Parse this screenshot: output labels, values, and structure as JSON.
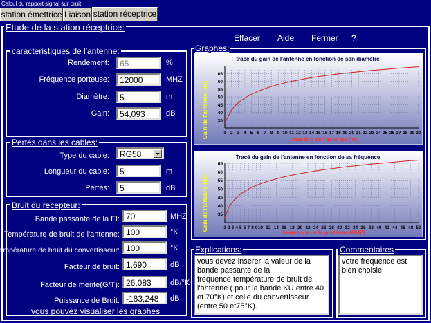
{
  "window_title": "Calcul du rapport signal sur bruit",
  "tabs": [
    {
      "label": "station émettrice",
      "active": false
    },
    {
      "label": "Liaison",
      "active": false
    },
    {
      "label": "station réceptrice",
      "active": true
    }
  ],
  "main_frame_title": "Etude de la station réceptrice:",
  "menu": {
    "effacer": "Effacer",
    "aide": "Aide",
    "fermer": "Fermer",
    "help": "?"
  },
  "antenna": {
    "title": "caracteristiques de l'antenne:",
    "rendement_label": "Rendement:",
    "rendement_value": "65",
    "rendement_unit": "%",
    "frequence_label": "Fréquence porteuse:",
    "frequence_value": "12000",
    "frequence_unit": "MHZ",
    "diametre_label": "Diamètre:",
    "diametre_value": "5",
    "diametre_unit": "m",
    "gain_label": "Gain:",
    "gain_value": "54,093",
    "gain_unit": "dB"
  },
  "cables": {
    "title": "Pertes dans les cables:",
    "type_label": "Type du cable:",
    "type_value": "RG58",
    "longueur_label": "Longueur du cable:",
    "longueur_value": "5",
    "longueur_unit": "m",
    "pertes_label": "Pertes:",
    "pertes_value": "5",
    "pertes_unit": "dB"
  },
  "noise": {
    "title": "Bruit du recepteur:",
    "bande_label": "Bande passante de la FI:",
    "bande_value": "70",
    "bande_unit": "MHZ",
    "temp_antenne_label": "Température de bruit de l'antenne:",
    "temp_antenne_value": "100",
    "temp_antenne_unit": "°K",
    "temp_conv_label": "Température de bruit du convertisseur:",
    "temp_conv_value": "100",
    "temp_conv_unit": "°K",
    "facteur_label": "Facteur de bruit:",
    "facteur_value": "1,690",
    "facteur_unit": "dB",
    "merite_label": "Facteur de merite(G/T):",
    "merite_value": "26,083",
    "merite_unit": "dB/°K",
    "puissance_label": "Puissance de Bruit:",
    "puissance_value": "-183,248",
    "puissance_unit": "dB"
  },
  "visualize_text": "vous pouvez visualiser les graphes",
  "graphs_title": "Graphes:",
  "explanations_title": "Explications:",
  "explanations_text": "vous devez inserer la valeur de la bande passante de la frequence,température de bruit de l'antenne ( pour la bande KU entre 40 et 70°K) et celle du convertisseur (entre 50 et75°K).",
  "comments_title": "Commentaires",
  "comments_text": "votre frequence est bien choisie",
  "colors": {
    "background": "#000080",
    "curve": "#d02020",
    "axis_label": "#ffff00",
    "xlabel": "#ff3030"
  },
  "chart_data": [
    {
      "type": "line",
      "title": "tracé du gain de l'antenne en fonction de son diamètre",
      "xlabel": "diamètre de l'antenne (m)",
      "ylabel": "Gain de l'antenne (dB)",
      "xlim": [
        1,
        30
      ],
      "ylim": [
        30,
        70
      ],
      "x_ticks": [
        1,
        2,
        3,
        4,
        5,
        6,
        7,
        8,
        9,
        10,
        11,
        12,
        13,
        14,
        15,
        16,
        17,
        18,
        19,
        20,
        21,
        22,
        23,
        24,
        25,
        26,
        27,
        28,
        29,
        30
      ],
      "y_ticks": [
        35,
        40,
        45,
        50,
        55,
        60,
        65
      ],
      "series": [
        {
          "x": [
            1,
            2,
            3,
            4,
            5,
            6,
            7,
            8,
            9,
            10,
            11,
            12,
            13,
            14,
            15,
            16,
            17,
            18,
            19,
            20,
            21,
            22,
            23,
            24,
            25,
            26,
            27,
            28,
            29,
            30
          ],
          "y": [
            33.2,
            41.7,
            46.2,
            49.3,
            51.7,
            53.7,
            55.3,
            56.7,
            57.9,
            59.0,
            60.0,
            60.8,
            61.6,
            62.3,
            63.0,
            63.6,
            64.2,
            64.7,
            65.2,
            65.7,
            66.1,
            66.6,
            67.0,
            67.3,
            67.7,
            68.0,
            68.4,
            68.7,
            69.0,
            69.3
          ]
        }
      ]
    },
    {
      "type": "line",
      "title": "Tracé du gain de l'antenne en fonction de sa fréquence",
      "xlabel": "fréquence de la porteuse (GHZ)",
      "ylabel": "Gain de l'antenne (dB)",
      "xlim": [
        1,
        50
      ],
      "ylim": [
        30,
        65
      ],
      "x_ticks": [
        1,
        2,
        3,
        4,
        5,
        6,
        7,
        8,
        9,
        10,
        12,
        14,
        16,
        18,
        20,
        22,
        24,
        26,
        28,
        30,
        32,
        34,
        36,
        38,
        40,
        42,
        44,
        46,
        48,
        50
      ],
      "y_ticks": [
        35,
        40,
        45,
        50,
        55,
        60,
        65
      ],
      "series": [
        {
          "x": [
            1,
            2,
            3,
            4,
            5,
            6,
            7,
            8,
            9,
            10,
            12,
            14,
            16,
            18,
            20,
            22,
            24,
            26,
            28,
            30,
            32,
            34,
            36,
            38,
            40,
            42,
            44,
            46,
            48,
            50
          ],
          "y": [
            33.0,
            39.0,
            42.5,
            45.0,
            46.9,
            48.5,
            49.8,
            51.0,
            52.0,
            52.9,
            54.5,
            55.8,
            57.0,
            58.0,
            58.9,
            59.7,
            60.5,
            61.2,
            61.8,
            62.4,
            63.0,
            63.5,
            64.0,
            64.5,
            64.9,
            65.3,
            65.7,
            66.1,
            66.5,
            66.8
          ]
        }
      ]
    }
  ]
}
